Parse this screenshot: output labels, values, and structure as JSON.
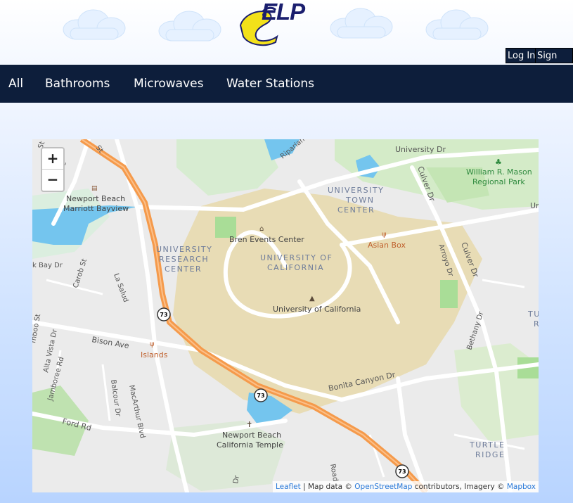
{
  "header": {
    "logo_text": "ELP",
    "login_label": "Log In",
    "signup_label": "Sign Up"
  },
  "nav": {
    "items": [
      {
        "label": "All"
      },
      {
        "label": "Bathrooms"
      },
      {
        "label": "Microwaves"
      },
      {
        "label": "Water Stations"
      }
    ]
  },
  "map": {
    "zoom_in": "+",
    "zoom_out": "−",
    "attribution": {
      "leaflet": "Leaflet",
      "sep": " | Map data © ",
      "osm": "OpenStreetMap",
      "contrib": " contributors, Imagery © ",
      "mapbox": "Mapbox"
    },
    "labels": {
      "university_dr": "University Dr",
      "riparian": "Riparian",
      "culver_dr_1": "Culver Dr",
      "culver_dr_2": "Culver Dr",
      "mason_park_1": "William R. Mason",
      "mason_park_2": "Regional Park",
      "un": "Un",
      "town_center_1": "UNIVERSITY",
      "town_center_2": "TOWN",
      "town_center_3": "CENTER",
      "marriott_1": "Newport Beach",
      "marriott_2": "Marriott Bayview",
      "bren": "Bren Events Center",
      "asian_box": "Asian Box",
      "research_1": "UNIVERSITY",
      "research_2": "RESEARCH",
      "research_3": "CENTER",
      "uc_area_1": "UNIVERSITY OF",
      "uc_area_2": "CALIFORNIA",
      "arroyo": "Arroyo Dr",
      "back_bay": "k Bay Dr",
      "carob": "Carob St",
      "la_salud": "La Salud",
      "uc_poi": "University of California",
      "bethany": "Bethany Dr",
      "tu_1": "TU",
      "tu_2": "R",
      "jamboree": "Jamboree Rd",
      "alta_vista": "Alta Vista Dr",
      "bamboo": "mboo St",
      "bison": "Bison Ave",
      "islands": "Islands",
      "balcour": "Balcour Dr",
      "macarthur": "MacArthur Blvd",
      "bonita": "Bonita Canyon Dr",
      "ford": "Ford Rd",
      "temple_1": "Newport Beach",
      "temple_2": "California Temple",
      "turtle_1": "TURTLE",
      "turtle_2": "RIDGE",
      "st_top": "St",
      "ave_top": "Ave",
      "st_left": "St",
      "dr_bottom": "Dr",
      "rd_bottom": "Road",
      "route_73": "73"
    }
  }
}
